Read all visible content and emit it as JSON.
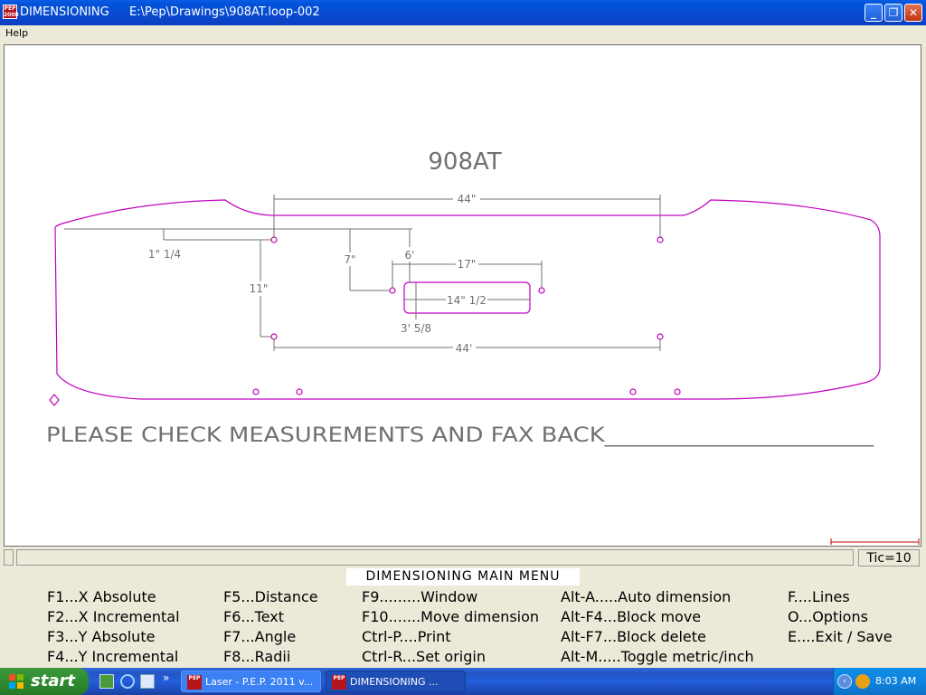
{
  "window": {
    "app_title": "DIMENSIONING",
    "file_path": "E:\\Pep\\Drawings\\908AT.loop-002",
    "icon_text": "PEP 2008",
    "minimize_icon": "minimize-icon",
    "maximize_icon": "restore-icon",
    "close_icon": "close-icon"
  },
  "menubar": {
    "help": "Help"
  },
  "drawing": {
    "title": "908AT",
    "dimensions": {
      "top_width": "44\"",
      "bottom_width": "44'",
      "offset_left": "1\" 1/4",
      "vertical_7": "7\"",
      "vertical_11": "11\"",
      "vertical_6": "6'",
      "slot_spacing": "17\"",
      "slot_length": "14\" 1/2",
      "slot_height": "3' 5/8"
    },
    "note": "PLEASE CHECK MEASUREMENTS AND FAX BACK_______________________",
    "line_color": "#c000c0",
    "dim_color": "#707070"
  },
  "status": {
    "tic": "Tic=10"
  },
  "main_menu": {
    "title": "DIMENSIONING MAIN MENU",
    "col1": [
      "F1...X Absolute",
      "F2...X Incremental",
      "F3...Y Absolute",
      "F4...Y Incremental"
    ],
    "col2": [
      "F5...Distance",
      "F6...Text",
      "F7...Angle",
      "F8...Radii"
    ],
    "col3": [
      "F9.........Window",
      "F10.......Move dimension",
      "Ctrl-P....Print",
      "Ctrl-R...Set origin"
    ],
    "col4": [
      "Alt-A.....Auto dimension",
      "Alt-F4...Block move",
      "Alt-F7...Block delete",
      "Alt-M.....Toggle metric/inch"
    ],
    "col5": [
      "F....Lines",
      "O...Options",
      "E....Exit / Save"
    ]
  },
  "taskbar": {
    "start": "start",
    "tasks": [
      "Laser - P.E.P. 2011 v...",
      "DIMENSIONING      ..."
    ],
    "clock": "8:03 AM"
  }
}
